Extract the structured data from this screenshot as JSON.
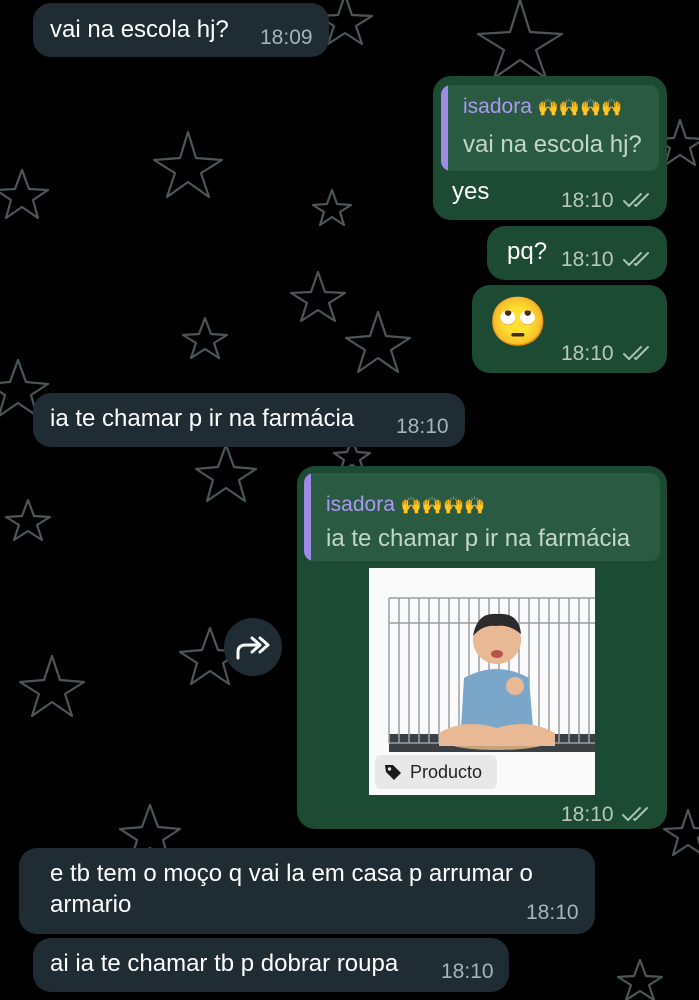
{
  "colors": {
    "background": "#000000",
    "incoming_bubble": "#1f2c34",
    "outgoing_bubble": "#1d4a33",
    "quote_name": "#a99af0",
    "tick": "#a8c3b5"
  },
  "messages": [
    {
      "text": "vai na escola hj?",
      "time": "18:09"
    },
    {
      "quote_name": "isadora",
      "quote_emoji": "🙌🙌🙌🙌",
      "quote_text": "vai na escola hj?",
      "text": "yes",
      "time": "18:10"
    },
    {
      "text": "pq?",
      "time": "18:10"
    },
    {
      "emoji": "🙄",
      "time": "18:10"
    },
    {
      "text": "ia te chamar p ir na farmácia",
      "time": "18:10"
    },
    {
      "quote_name": "isadora",
      "quote_emoji": "🙌🙌🙌🙌",
      "quote_text": "ia te chamar p ir na farmácia",
      "tag_label": "Producto",
      "time": "18:10"
    },
    {
      "text_line1": "e tb tem o moço q vai la em casa p arrumar o",
      "text_line2": "armario",
      "time": "18:10"
    },
    {
      "text": "ai ia te chamar tb p dobrar roupa",
      "time": "18:10"
    }
  ],
  "icons": {
    "read_receipt": "double-check-icon",
    "forward": "forward-icon",
    "tag": "tag-icon"
  }
}
